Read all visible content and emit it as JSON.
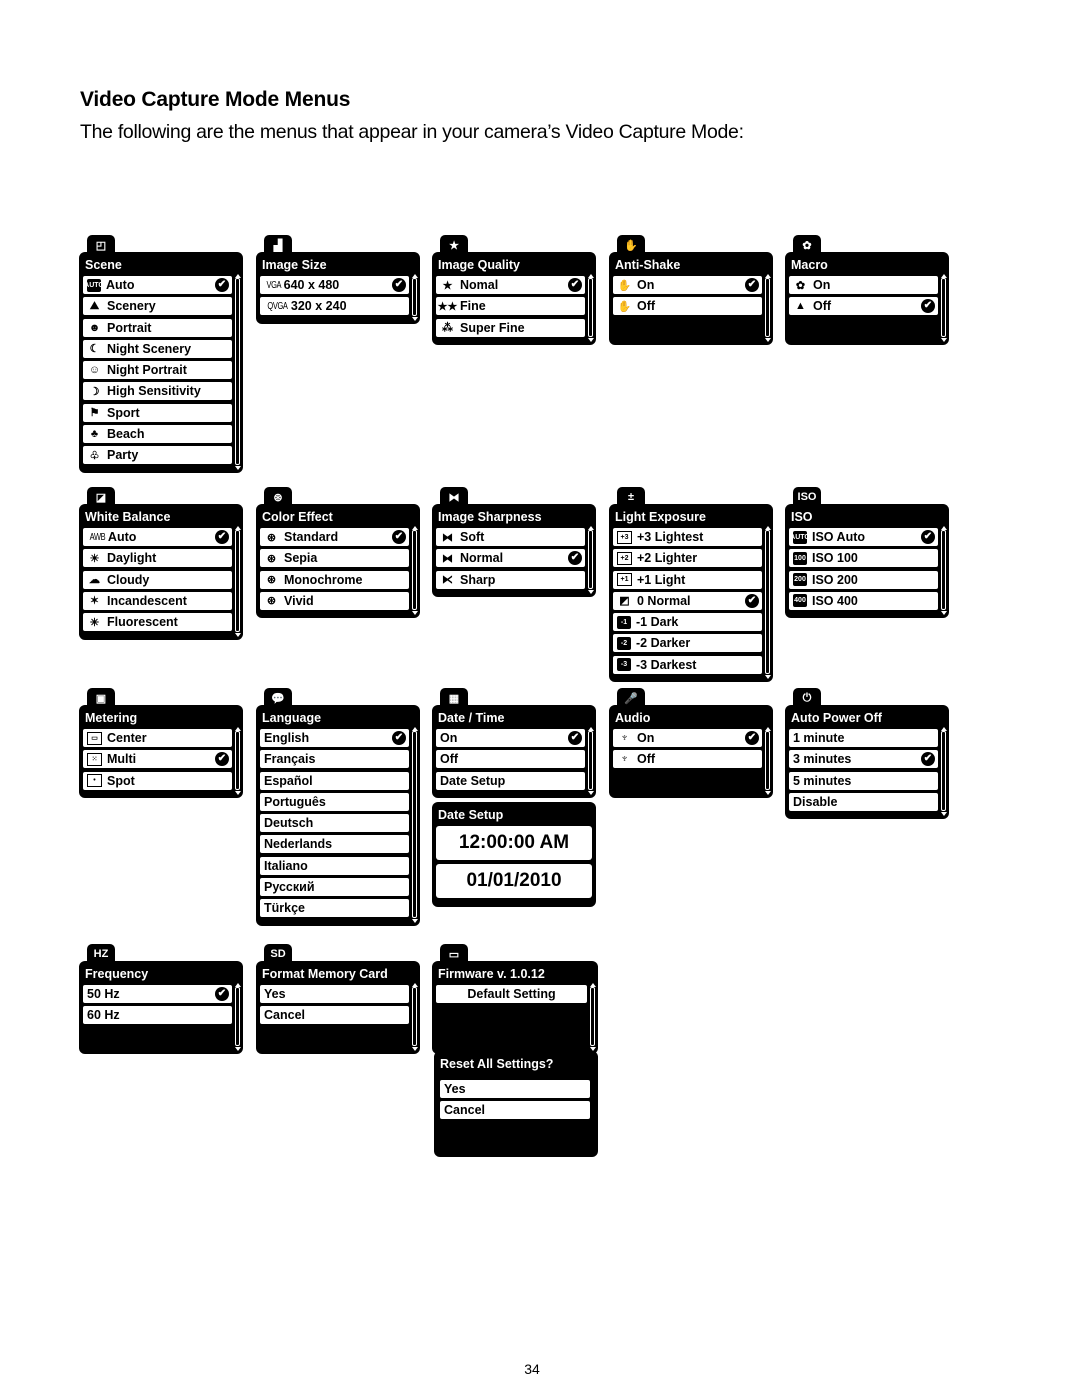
{
  "heading": "Video Capture Mode Menus",
  "intro": "The following are the menus that appear in your camera’s Video Capture Mode:",
  "page_number": "34",
  "menus": {
    "scene": {
      "tab_icon": "scene-icon",
      "tab_glyph": "◰",
      "title": "Scene",
      "items": [
        {
          "label": "Auto",
          "icon": "auto-icon",
          "glyph": "AUTO",
          "checked": true
        },
        {
          "label": "Scenery",
          "icon": "scenery-icon",
          "glyph": "⛰"
        },
        {
          "label": "Portrait",
          "icon": "portrait-icon",
          "glyph": "☻"
        },
        {
          "label": "Night Scenery",
          "icon": "night-scenery-icon",
          "glyph": "☾"
        },
        {
          "label": "Night Portrait",
          "icon": "night-portrait-icon",
          "glyph": "☺"
        },
        {
          "label": "High Sensitivity",
          "icon": "high-sensitivity-icon",
          "glyph": "☽"
        },
        {
          "label": "Sport",
          "icon": "sport-icon",
          "glyph": "⚑"
        },
        {
          "label": "Beach",
          "icon": "beach-icon",
          "glyph": "♣"
        },
        {
          "label": "Party",
          "icon": "party-icon",
          "glyph": "♧"
        }
      ]
    },
    "image_size": {
      "tab_icon": "image-size-icon",
      "tab_glyph": "▟",
      "title": "Image Size",
      "items": [
        {
          "label": "640 x 480",
          "prefix": "VGA",
          "checked": true
        },
        {
          "label": "320 x 240",
          "prefix": "QVGA"
        }
      ]
    },
    "image_quality": {
      "tab_icon": "star-icon",
      "tab_glyph": "★",
      "title": "Image Quality",
      "items": [
        {
          "label": "Nomal",
          "glyph": "★",
          "icon": "one-star-icon",
          "checked": true
        },
        {
          "label": "Fine",
          "glyph": "★★",
          "icon": "two-star-icon"
        },
        {
          "label": "Super Fine",
          "glyph": "⁂",
          "icon": "three-star-icon"
        }
      ]
    },
    "anti_shake": {
      "tab_icon": "hand-icon",
      "tab_glyph": "✋",
      "title": "Anti-Shake",
      "items": [
        {
          "label": "On",
          "glyph": "✋",
          "icon": "anti-shake-on-icon",
          "checked": true
        },
        {
          "label": "Off",
          "glyph": "✋",
          "icon": "anti-shake-off-icon"
        }
      ]
    },
    "macro": {
      "tab_icon": "flower-icon",
      "tab_glyph": "✿",
      "title": "Macro",
      "items": [
        {
          "label": "On",
          "glyph": "✿",
          "icon": "macro-on-icon"
        },
        {
          "label": "Off",
          "glyph": "▲",
          "icon": "mountain-icon",
          "checked": true
        }
      ]
    },
    "white_balance": {
      "tab_icon": "white-balance-icon",
      "tab_glyph": "◪",
      "title": "White Balance",
      "items": [
        {
          "label": "Auto",
          "prefix": "AWB",
          "checked": true
        },
        {
          "label": "Daylight",
          "glyph": "☀",
          "icon": "sun-icon"
        },
        {
          "label": "Cloudy",
          "glyph": "☁",
          "icon": "cloud-icon"
        },
        {
          "label": "Incandescent",
          "glyph": "✶",
          "icon": "bulb-icon"
        },
        {
          "label": "Fluorescent",
          "glyph": "✳",
          "icon": "fluorescent-icon"
        }
      ]
    },
    "color_effect": {
      "tab_icon": "color-effect-icon",
      "tab_glyph": "⊛",
      "title": "Color Effect",
      "items": [
        {
          "label": "Standard",
          "glyph": "⊛",
          "icon": "standard-icon",
          "checked": true
        },
        {
          "label": "Sepia",
          "glyph": "⊛",
          "icon": "sepia-icon"
        },
        {
          "label": "Monochrome",
          "glyph": "⊛",
          "icon": "monochrome-icon"
        },
        {
          "label": "Vivid",
          "glyph": "⊛",
          "icon": "vivid-icon"
        }
      ]
    },
    "sharpness": {
      "tab_icon": "sharpness-icon",
      "tab_glyph": "⧓",
      "title": "Image Sharpness",
      "items": [
        {
          "label": "Soft",
          "glyph": "⧓",
          "icon": "soft-icon"
        },
        {
          "label": "Normal",
          "glyph": "⧓",
          "icon": "normal-sharp-icon",
          "checked": true
        },
        {
          "label": "Sharp",
          "glyph": "⧔",
          "icon": "sharp-icon"
        }
      ]
    },
    "exposure": {
      "tab_icon": "exposure-icon",
      "tab_glyph": "±",
      "title": "Light Exposure",
      "items": [
        {
          "label": "+3 Lightest",
          "glyph": "+3",
          "icon": "ev-plus3-icon"
        },
        {
          "label": "+2 Lighter",
          "glyph": "+2",
          "icon": "ev-plus2-icon"
        },
        {
          "label": "+1 Light",
          "glyph": "+1",
          "icon": "ev-plus1-icon"
        },
        {
          "label": "0 Normal",
          "glyph": "◩",
          "icon": "ev-zero-icon",
          "checked": true
        },
        {
          "label": "-1 Dark",
          "glyph": "-1",
          "icon": "ev-minus1-icon"
        },
        {
          "label": "-2 Darker",
          "glyph": "-2",
          "icon": "ev-minus2-icon"
        },
        {
          "label": "-3 Darkest",
          "glyph": "-3",
          "icon": "ev-minus3-icon"
        }
      ]
    },
    "iso": {
      "tab_icon": "iso-icon",
      "tab_glyph": "ISO",
      "title": "ISO",
      "items": [
        {
          "label": "ISO Auto",
          "glyph": "AUTO",
          "icon": "iso-auto-icon",
          "checked": true
        },
        {
          "label": "ISO 100",
          "glyph": "100",
          "icon": "iso-100-icon"
        },
        {
          "label": "ISO 200",
          "glyph": "200",
          "icon": "iso-200-icon"
        },
        {
          "label": "ISO 400",
          "glyph": "400",
          "icon": "iso-400-icon"
        }
      ]
    },
    "metering": {
      "tab_icon": "metering-icon",
      "tab_glyph": "▣",
      "title": "Metering",
      "items": [
        {
          "label": "Center",
          "glyph": "▭",
          "icon": "center-metering-icon"
        },
        {
          "label": "Multi",
          "glyph": "⁙",
          "icon": "multi-metering-icon",
          "checked": true
        },
        {
          "label": "Spot",
          "glyph": "•",
          "icon": "spot-metering-icon"
        }
      ]
    },
    "language": {
      "tab_icon": "speech-bubble-icon",
      "tab_glyph": "💬",
      "title": "Language",
      "items": [
        {
          "label": "English",
          "checked": true
        },
        {
          "label": "Français"
        },
        {
          "label": "Español"
        },
        {
          "label": "Português"
        },
        {
          "label": "Deutsch"
        },
        {
          "label": "Nederlands"
        },
        {
          "label": "Italiano"
        },
        {
          "label": "Русский"
        },
        {
          "label": "Türkçe"
        }
      ]
    },
    "date_time": {
      "tab_icon": "calendar-icon",
      "tab_glyph": "▦",
      "title": "Date / Time",
      "items": [
        {
          "label": "On",
          "checked": true
        },
        {
          "label": "Off"
        },
        {
          "label": "Date Setup"
        }
      ]
    },
    "date_setup": {
      "title": "Date Setup",
      "time": "12:00:00 AM",
      "date": "01/01/2010"
    },
    "audio": {
      "tab_icon": "microphone-icon",
      "tab_glyph": "🎤",
      "title": "Audio",
      "items": [
        {
          "label": "On",
          "glyph": "♆",
          "icon": "mic-on-icon",
          "checked": true
        },
        {
          "label": "Off",
          "glyph": "♆",
          "icon": "mic-off-icon"
        }
      ]
    },
    "auto_power_off": {
      "tab_icon": "power-icon",
      "tab_glyph": "⏻",
      "title": "Auto Power Off",
      "items": [
        {
          "label": "1 minute"
        },
        {
          "label": "3 minutes",
          "checked": true
        },
        {
          "label": "5 minutes"
        },
        {
          "label": "Disable"
        }
      ]
    },
    "frequency": {
      "tab_icon": "hz-icon",
      "tab_glyph": "HZ",
      "title": "Frequency",
      "items": [
        {
          "label": "50 Hz",
          "checked": true
        },
        {
          "label": "60 Hz"
        }
      ]
    },
    "format": {
      "tab_icon": "sd-card-icon",
      "tab_glyph": "SD",
      "title": "Format Memory Card",
      "items": [
        {
          "label": "Yes"
        },
        {
          "label": "Cancel"
        }
      ]
    },
    "firmware": {
      "tab_icon": "window-icon",
      "tab_glyph": "▭",
      "title": "Firmware v. 1.0.12",
      "items": [
        {
          "label": "Default Setting"
        }
      ]
    },
    "reset": {
      "title": "Reset All Settings?",
      "items": [
        {
          "label": "Yes"
        },
        {
          "label": "Cancel"
        }
      ]
    }
  },
  "check_glyph": "✔"
}
